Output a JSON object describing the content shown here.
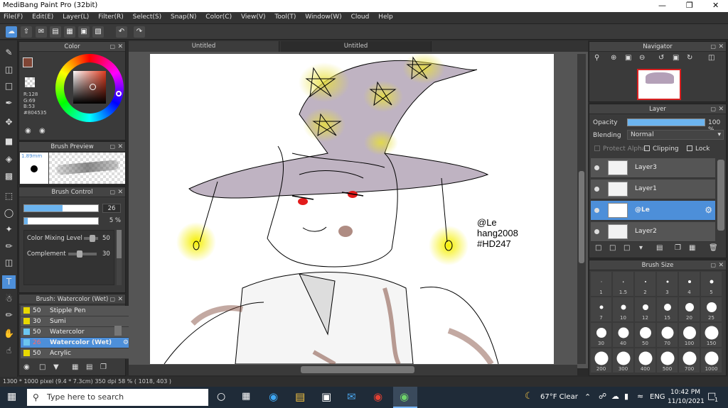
{
  "app": {
    "title": "MediBang Paint Pro (32bit)"
  },
  "menu": [
    "File(F)",
    "Edit(E)",
    "Layer(L)",
    "Filter(R)",
    "Select(S)",
    "Snap(N)",
    "Color(C)",
    "View(V)",
    "Tool(T)",
    "Window(W)",
    "Cloud",
    "Help"
  ],
  "color_panel": {
    "title": "Color",
    "r": "R:128",
    "g": "G:69",
    "b": "B:53",
    "hex": "#804535",
    "fg": "#804535"
  },
  "brush_preview": {
    "title": "Brush Preview",
    "size": "1.89mm"
  },
  "brush_control": {
    "title": "Brush Control",
    "size_value": "26",
    "opacity_value": "5 %",
    "mix_label": "Color Mixing Level",
    "mix_value": "50",
    "comp_label": "Complement",
    "comp_value": "30"
  },
  "brush_list": {
    "title": "Brush: Watercolor (Wet)",
    "items": [
      {
        "size": "50",
        "name": "Stipple Pen",
        "color": "#e8d800"
      },
      {
        "size": "30",
        "name": "Sumi",
        "color": "#e8d800"
      },
      {
        "size": "50",
        "name": "Watercolor",
        "color": "#6cc6f0"
      },
      {
        "size": "26",
        "name": "Watercolor (Wet)",
        "color": "#6cc6f0"
      },
      {
        "size": "50",
        "name": "Acrylic",
        "color": "#e8d800"
      }
    ]
  },
  "tabs": [
    "Untitled",
    "Untitled"
  ],
  "canvas_text": {
    "line1": "@Le",
    "line2": "hang2008",
    "line3": "#HD247"
  },
  "navigator": {
    "title": "Navigator"
  },
  "layer_panel": {
    "title": "Layer",
    "opacity_label": "Opacity",
    "opacity_value": "100 %",
    "blending_label": "Blending",
    "blending_value": "Normal",
    "protect_alpha": "Protect Alpha",
    "clipping": "Clipping",
    "lock": "Lock",
    "layers": [
      "Layer3",
      "Layer1",
      "@Le",
      "Layer2"
    ]
  },
  "brush_size": {
    "title": "Brush Size",
    "sizes": [
      "1",
      "1.5",
      "2",
      "3",
      "4",
      "5",
      "7",
      "10",
      "12",
      "15",
      "20",
      "25",
      "30",
      "40",
      "50",
      "70",
      "100",
      "150",
      "200",
      "300",
      "400",
      "500",
      "700",
      "1000"
    ]
  },
  "status": "1300 * 1000 pixel  (9.4 * 7.3cm)  350 dpi  58 %  ( 1018, 403 )",
  "taskbar": {
    "search": "Type here to search",
    "weather": "67°F  Clear",
    "lang": "ENG",
    "time": "10:42 PM",
    "date": "11/10/2021",
    "notif": "1"
  }
}
